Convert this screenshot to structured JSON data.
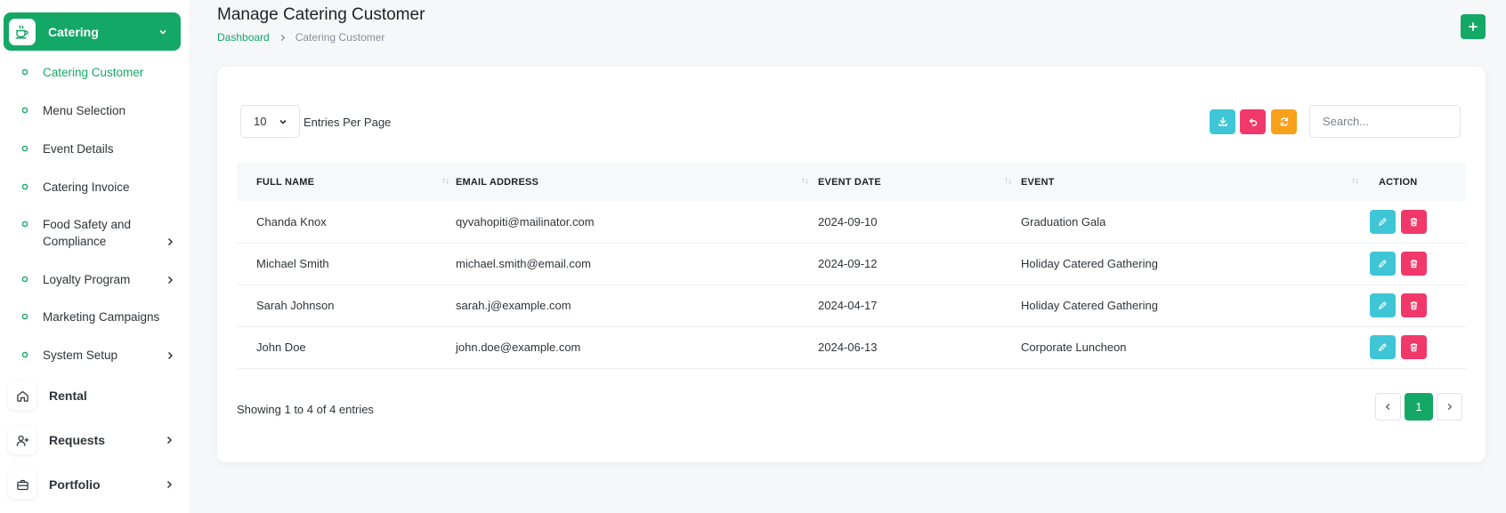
{
  "sidebar": {
    "active_group": {
      "label": "Catering",
      "icon": "coffee-cup-icon"
    },
    "sub_items": [
      {
        "label": "Catering Customer",
        "active": true,
        "has_arrow": false
      },
      {
        "label": "Menu Selection",
        "active": false,
        "has_arrow": false
      },
      {
        "label": "Event Details",
        "active": false,
        "has_arrow": false
      },
      {
        "label": "Catering Invoice",
        "active": false,
        "has_arrow": false
      },
      {
        "label": "Food Safety and Compliance",
        "active": false,
        "has_arrow": true
      },
      {
        "label": "Loyalty Program",
        "active": false,
        "has_arrow": true
      },
      {
        "label": "Marketing Campaigns",
        "active": false,
        "has_arrow": false
      },
      {
        "label": "System Setup",
        "active": false,
        "has_arrow": true
      }
    ],
    "groups": [
      {
        "label": "Rental",
        "icon": "home-icon",
        "has_arrow": false
      },
      {
        "label": "Requests",
        "icon": "user-plus-icon",
        "has_arrow": true
      },
      {
        "label": "Portfolio",
        "icon": "briefcase-icon",
        "has_arrow": true
      }
    ]
  },
  "header": {
    "title": "Manage Catering Customer",
    "breadcrumb": {
      "home": "Dashboard",
      "current": "Catering Customer"
    },
    "add_button_icon": "plus-icon"
  },
  "toolbar": {
    "entries_value": "10",
    "entries_label": "Entries Per Page",
    "search_placeholder": "Search...",
    "buttons": [
      {
        "name": "download-button",
        "icon": "download-icon",
        "color": "#3ec6d6"
      },
      {
        "name": "undo-button",
        "icon": "undo-icon",
        "color": "#f0386b"
      },
      {
        "name": "refresh-button",
        "icon": "refresh-icon",
        "color": "#f9a11b"
      }
    ]
  },
  "table": {
    "columns": [
      "FULL NAME",
      "EMAIL ADDRESS",
      "EVENT DATE",
      "EVENT",
      "ACTION"
    ],
    "rows": [
      {
        "name": "Chanda Knox",
        "email": "qyvahopiti@mailinator.com",
        "date": "2024-09-10",
        "event": "Graduation Gala"
      },
      {
        "name": "Michael Smith",
        "email": "michael.smith@email.com",
        "date": "2024-09-12",
        "event": "Holiday Catered Gathering"
      },
      {
        "name": "Sarah Johnson",
        "email": "sarah.j@example.com",
        "date": "2024-04-17",
        "event": "Holiday Catered Gathering"
      },
      {
        "name": "John Doe",
        "email": "john.doe@example.com",
        "date": "2024-06-13",
        "event": "Corporate Luncheon"
      }
    ]
  },
  "footer": {
    "showing_text": "Showing 1 to 4 of 4 entries",
    "current_page": "1"
  },
  "colors": {
    "accent": "#14a866",
    "edit": "#3ec6d6",
    "delete": "#f0386b",
    "refresh": "#f9a11b"
  }
}
